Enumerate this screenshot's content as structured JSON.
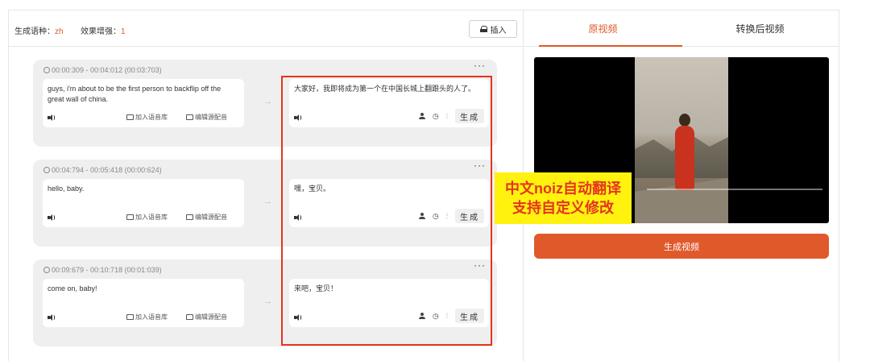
{
  "header": {
    "lang_label": "生成语种：",
    "lang_value": "zh",
    "enhance_label": "效果增强：",
    "enhance_value": "1",
    "insert_label": "插入"
  },
  "rows": [
    {
      "time": "00:00:309 - 00:04:012 (00:03:703)",
      "source": "guys, i'm about to be the first person to backflip off the great wall of china.",
      "translation": "大家好，我即将成为第一个在中国长城上翻跟头的人了。"
    },
    {
      "time": "00:04:794 - 00:05:418 (00:00:624)",
      "source": "hello, baby.",
      "translation": "嘿，宝贝。"
    },
    {
      "time": "00:09:679 - 00:10:718 (00:01:039)",
      "source": "come on, baby!",
      "translation": "来吧，宝贝！"
    }
  ],
  "row_actions": {
    "add_voice_library": "加入语音库",
    "edit_source_dub": "编辑源配音",
    "generate": "生成",
    "more": "···",
    "arrow": "→"
  },
  "callout": {
    "line1": "中文noiz自动翻译",
    "line2": "支持自定义修改"
  },
  "tabs": {
    "original": "原视频",
    "converted": "转换后视频",
    "active": "original"
  },
  "generate_video_label": "生成视频",
  "colors": {
    "accent": "#e0592a",
    "highlight_border": "#e53420",
    "callout_bg": "#fff20e"
  }
}
